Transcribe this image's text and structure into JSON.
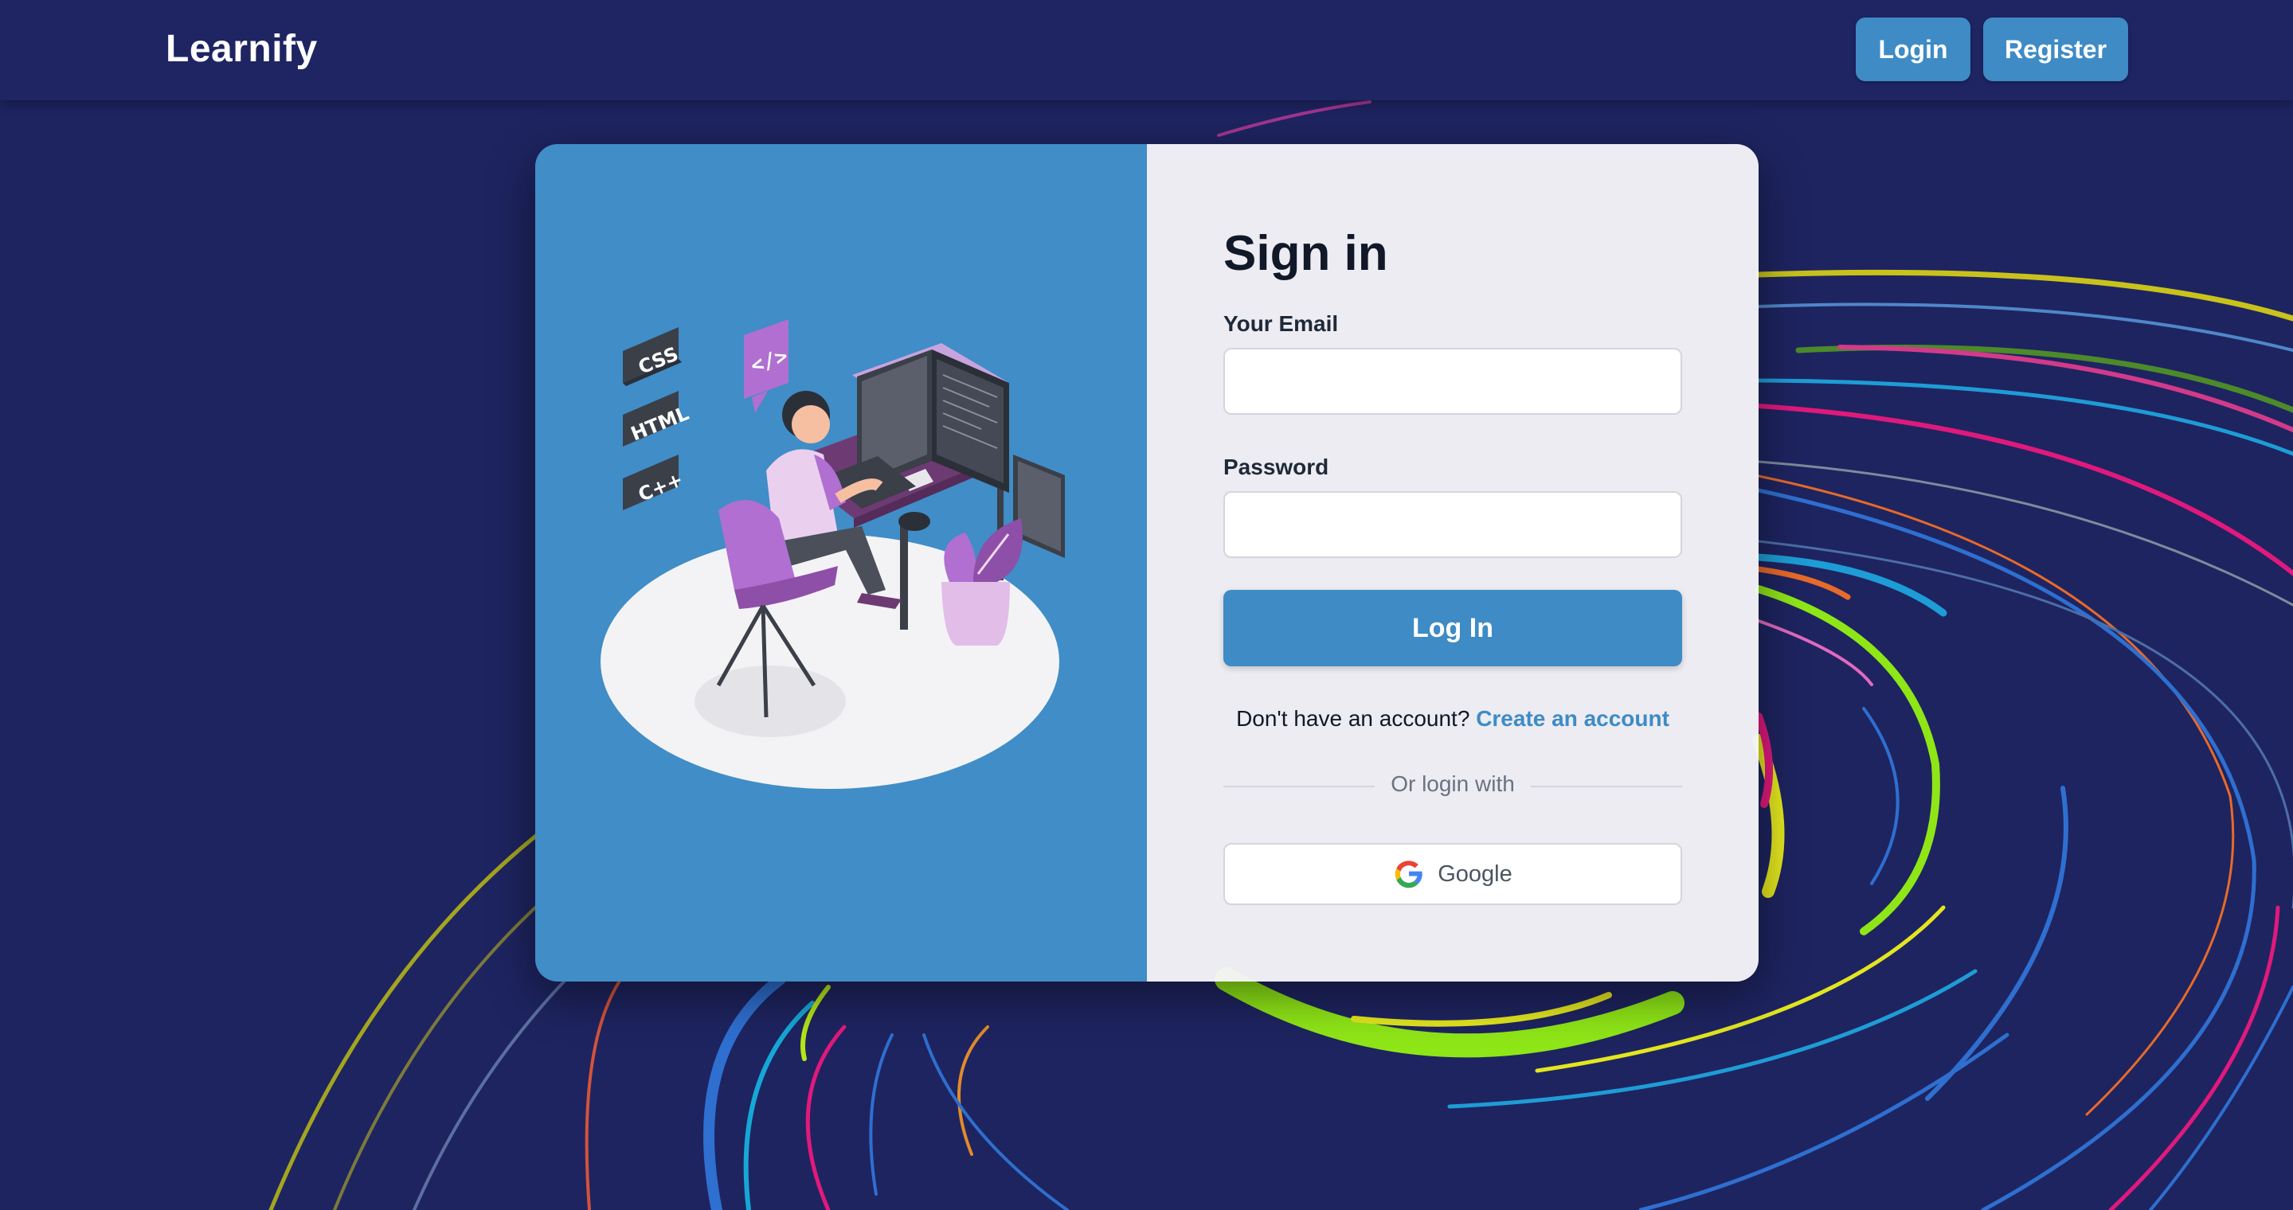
{
  "nav": {
    "brand": "Learnify",
    "login_label": "Login",
    "register_label": "Register"
  },
  "illustration": {
    "badges": [
      "CSS",
      "HTML",
      "C++"
    ],
    "code_symbol": "</>"
  },
  "signin": {
    "title": "Sign in",
    "email_label": "Your Email",
    "email_value": "",
    "password_label": "Password",
    "password_value": "",
    "submit_label": "Log In",
    "no_account_text": "Don't have an account?",
    "create_account_link": "Create an account",
    "divider_text": "Or login with",
    "google_label": "Google"
  },
  "colors": {
    "background": "#1e2460",
    "accent": "#3e8bc6",
    "card_left": "#408dc7",
    "card_right": "#f4f4f7"
  }
}
